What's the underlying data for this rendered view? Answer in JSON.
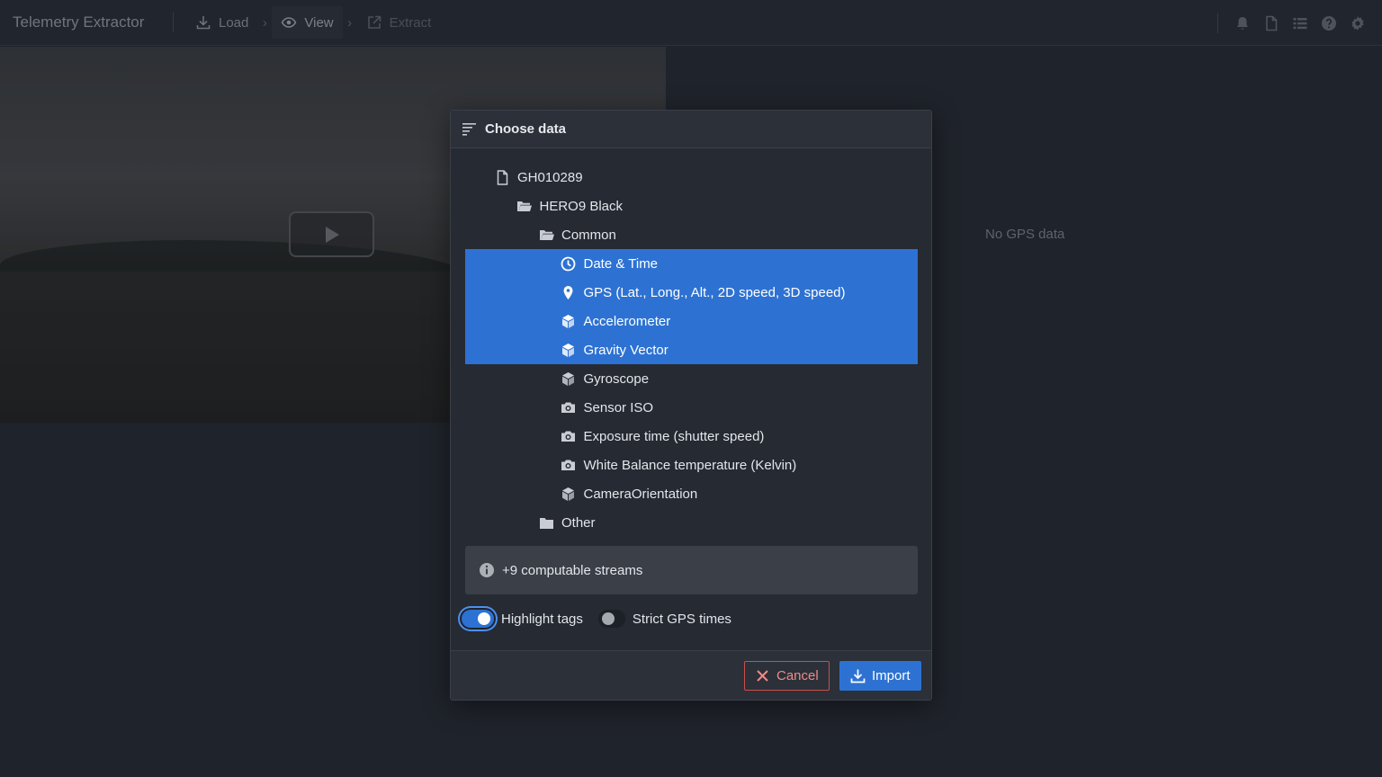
{
  "app": {
    "title": "Telemetry Extractor"
  },
  "nav": [
    {
      "label": "Load",
      "icon": "download-icon",
      "state": "normal"
    },
    {
      "label": "View",
      "icon": "eye-icon",
      "state": "active"
    },
    {
      "label": "Extract",
      "icon": "export-icon",
      "state": "disabled"
    }
  ],
  "top_icons": [
    "bell-icon",
    "document-icon",
    "list-icon",
    "help-icon",
    "gear-icon"
  ],
  "map": {
    "empty_text": "No GPS data"
  },
  "dialog": {
    "title": "Choose data",
    "tree": [
      {
        "label": "GH010289",
        "icon": "document-icon",
        "depth": 0,
        "selected": false
      },
      {
        "label": "HERO9 Black",
        "icon": "folder-open-icon",
        "depth": 1,
        "selected": false
      },
      {
        "label": "Common",
        "icon": "folder-open-icon",
        "depth": 2,
        "selected": false
      },
      {
        "label": "Date & Time",
        "icon": "clock-icon",
        "depth": 3,
        "selected": true
      },
      {
        "label": "GPS (Lat., Long., Alt., 2D speed, 3D speed)",
        "icon": "map-marker-icon",
        "depth": 3,
        "selected": true
      },
      {
        "label": "Accelerometer",
        "icon": "cube-icon",
        "depth": 3,
        "selected": true
      },
      {
        "label": "Gravity Vector",
        "icon": "cube-icon",
        "depth": 3,
        "selected": true
      },
      {
        "label": "Gyroscope",
        "icon": "cube-icon",
        "depth": 3,
        "selected": false
      },
      {
        "label": "Sensor ISO",
        "icon": "camera-icon",
        "depth": 3,
        "selected": false
      },
      {
        "label": "Exposure time (shutter speed)",
        "icon": "camera-icon",
        "depth": 3,
        "selected": false
      },
      {
        "label": "White Balance temperature (Kelvin)",
        "icon": "camera-icon",
        "depth": 3,
        "selected": false
      },
      {
        "label": "CameraOrientation",
        "icon": "cube-icon",
        "depth": 3,
        "selected": false
      },
      {
        "label": "Other",
        "icon": "folder-closed-icon",
        "depth": 2,
        "selected": false
      }
    ],
    "callout": "+9 computable streams",
    "switches": {
      "highlight": {
        "label": "Highlight tags",
        "checked": true
      },
      "strict_gps": {
        "label": "Strict GPS times",
        "checked": false
      }
    },
    "buttons": {
      "cancel": "Cancel",
      "import": "Import"
    }
  },
  "colors": {
    "accent": "#2d72d2",
    "danger": "#c9504b",
    "background": "#1f232b",
    "dialog": "#252a33"
  }
}
